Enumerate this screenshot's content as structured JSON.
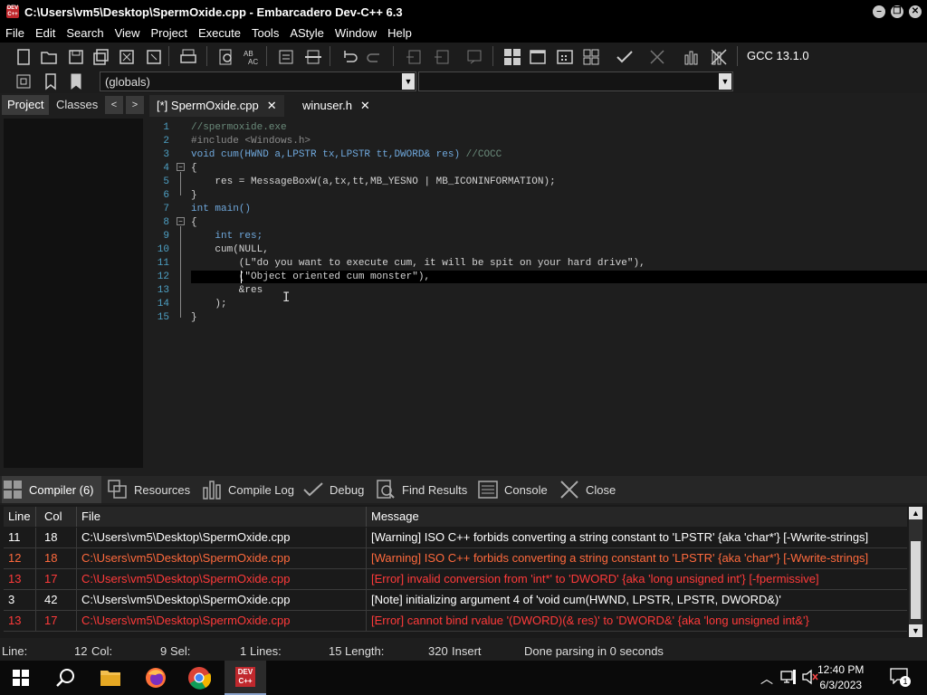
{
  "window": {
    "title": "C:\\Users\\vm5\\Desktop\\SpermOxide.cpp - Embarcadero Dev-C++ 6.3",
    "app_icon_label": "DEV C++"
  },
  "menu": [
    "File",
    "Edit",
    "Search",
    "View",
    "Project",
    "Execute",
    "Tools",
    "AStyle",
    "Window",
    "Help"
  ],
  "toolbar": {
    "compiler": "GCC 13.1.0",
    "scope_combo": "(globals)",
    "function_combo": ""
  },
  "left_panel": {
    "tabs": [
      "Project",
      "Classes"
    ],
    "prev": "<",
    "next": ">"
  },
  "editor": {
    "tabs": [
      {
        "label": "[*] SpermOxide.cpp",
        "close": "✕"
      },
      {
        "label": "winuser.h",
        "close": "✕"
      }
    ],
    "lines": [
      {
        "n": "1",
        "text": "//spermoxide.exe"
      },
      {
        "n": "2",
        "text": "#include <Windows.h>"
      },
      {
        "n": "3",
        "text": "void cum(HWND a,LPSTR tx,LPSTR tt,DWORD& res) //COCC"
      },
      {
        "n": "4",
        "text": "{"
      },
      {
        "n": "5",
        "text": "    res = MessageBoxW(a,tx,tt,MB_YESNO | MB_ICONINFORMATION);"
      },
      {
        "n": "6",
        "text": "}"
      },
      {
        "n": "7",
        "text": "int main()"
      },
      {
        "n": "8",
        "text": "{"
      },
      {
        "n": "9",
        "text": "    int res;"
      },
      {
        "n": "10",
        "text": "    cum(NULL,"
      },
      {
        "n": "11",
        "text": "        (L\"do you want to execute cum, it will be spit on your hard drive\"),"
      },
      {
        "n": "12",
        "text": "        (\"Object oriented cum monster\"),"
      },
      {
        "n": "13",
        "text": "        &res"
      },
      {
        "n": "14",
        "text": "    );"
      },
      {
        "n": "15",
        "text": "}"
      }
    ]
  },
  "bottom_tabs": [
    "Compiler (6)",
    "Resources",
    "Compile Log",
    "Debug",
    "Find Results",
    "Console",
    "Close"
  ],
  "messages": {
    "headers": [
      "Line",
      "Col",
      "File",
      "Message"
    ],
    "rows": [
      {
        "line": "11",
        "col": "18",
        "file": "C:\\Users\\vm5\\Desktop\\SpermOxide.cpp",
        "message": "[Warning] ISO C++ forbids converting a string constant to 'LPSTR' {aka 'char*'} [-Wwrite-strings]"
      },
      {
        "line": "12",
        "col": "18",
        "file": "C:\\Users\\vm5\\Desktop\\SpermOxide.cpp",
        "message": "[Warning] ISO C++ forbids converting a string constant to 'LPSTR' {aka 'char*'} [-Wwrite-strings]"
      },
      {
        "line": "13",
        "col": "17",
        "file": "C:\\Users\\vm5\\Desktop\\SpermOxide.cpp",
        "message": "[Error] invalid conversion from 'int*' to 'DWORD' {aka 'long unsigned int'} [-fpermissive]"
      },
      {
        "line": "3",
        "col": "42",
        "file": "C:\\Users\\vm5\\Desktop\\SpermOxide.cpp",
        "message": "[Note] initializing argument 4 of 'void cum(HWND, LPSTR, LPSTR, DWORD&)'"
      },
      {
        "line": "13",
        "col": "17",
        "file": "C:\\Users\\vm5\\Desktop\\SpermOxide.cpp",
        "message": "[Error] cannot bind rvalue '(DWORD)(& res)' to 'DWORD&' {aka 'long unsigned int&'}"
      }
    ]
  },
  "status": {
    "line_label": "Line:",
    "line_value": "12",
    "col_label": "Col:",
    "col_value": "9",
    "sel_label": "Sel:",
    "sel_value": "1",
    "lines_label": "Lines:",
    "lines_value": "15",
    "length_label": "Length:",
    "length_value": "320",
    "mode": "Insert",
    "message": "Done parsing in 0 seconds"
  },
  "taskbar": {
    "time": "12:40 PM",
    "date": "6/3/2023",
    "notification_count": "1",
    "devcpp_label": "DEV C++"
  },
  "colors": {
    "comment": "#6a8a7a",
    "keyword": "#6fa8dc",
    "string": "#e0e0e0",
    "line_number": "#4ea0c4",
    "error_red": "#ff3a3a",
    "warning_orange": "#ff6a3d"
  }
}
